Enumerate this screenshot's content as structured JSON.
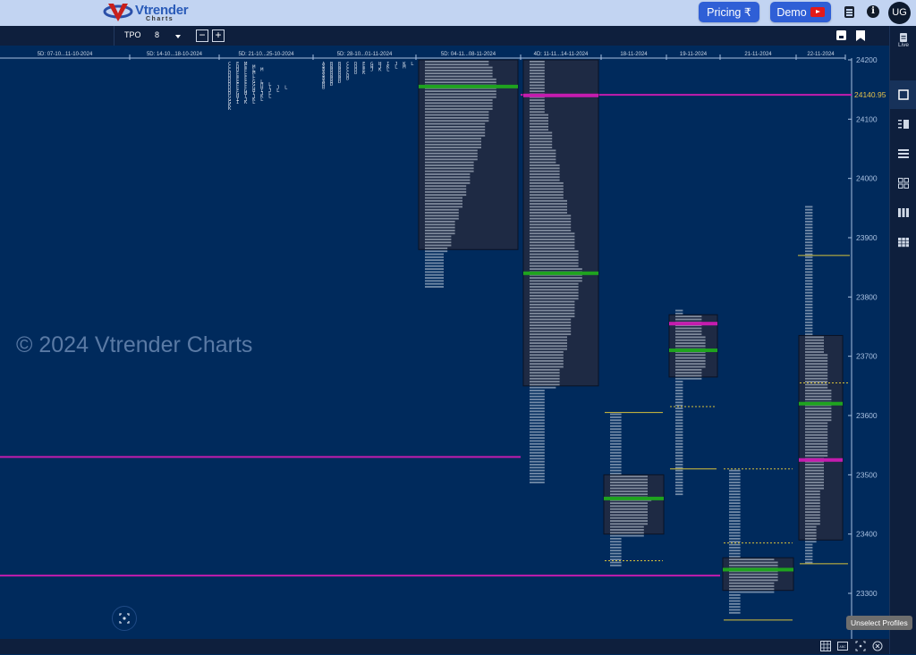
{
  "header": {
    "logo_text": "Vtrender",
    "logo_sub": "Charts",
    "pricing_label": "Pricing ₹",
    "demo_label": "Demo",
    "avatar_initials": "UG",
    "icons": [
      "notes-icon",
      "info-icon"
    ]
  },
  "toolbar": {
    "chart_type": "TPO",
    "tpo_size": "8",
    "zoom_out": "−",
    "zoom_in": "+",
    "icons": [
      "save-icon",
      "bookmark-add-icon"
    ]
  },
  "right_panel": {
    "live_label": "Live",
    "items": [
      "single-profile-icon",
      "split-profile-icon",
      "rows-icon",
      "grid-2x2-icon",
      "columns-icon",
      "grid-3x3-icon"
    ],
    "active_index": 0
  },
  "watermark": "© 2024 Vtrender Charts",
  "tooltip": "Unselect Profiles",
  "bottom_icons": [
    "table-icon",
    "abc-icon",
    "focus-icon",
    "close-circle-icon"
  ],
  "colors": {
    "background": "#002a5c",
    "profile_box": "#1e2a44",
    "poc_green": "#1fa31f",
    "vpoc_magenta": "#c41cae",
    "ib_yellow": "#d8c23a",
    "letters": "#cfd8e6",
    "axis": "#a8c0e0",
    "last_price": "#e6c14a"
  },
  "chart_data": {
    "type": "tpo_market_profile",
    "instrument_price_axis": "y",
    "y_ticks": [
      24200,
      24100,
      24000,
      23900,
      23800,
      23700,
      23600,
      23500,
      23400,
      23300
    ],
    "ylim": [
      23245,
      24225
    ],
    "last_price": "24140.95",
    "profiles": [
      {
        "label": "5D: 07-10...11-10-2024",
        "letters": []
      },
      {
        "label": "5D: 14-10...18-10-2024",
        "letters": []
      },
      {
        "label": "5D: 21-10...25-10-2024",
        "high": 24200,
        "low": 24080,
        "letters": [
          "CEM",
          "CDEM",
          "CDELM",
          "DELM",
          "DEFL",
          "DEFL",
          "DEFGL",
          "DEFGHL",
          "DEFGHIJL",
          "DFGHIJL",
          "DGHIJL",
          "GHIJKL",
          "GIJKL",
          "GIKL",
          "K",
          "K"
        ]
      },
      {
        "label": "5D: 28-10...01-11-2024",
        "high": 24200,
        "low": 24140,
        "letters": [
          "ABBCDEGHIJKLM",
          "ABBCDEHJKLM",
          "ABBCDEJKL",
          "ABBCDK",
          "ABBD",
          "ABBD",
          "ABD",
          "BD",
          "B"
        ]
      },
      {
        "label": "5D: 04-11...08-11-2024",
        "high": 24200,
        "low": 23815,
        "poc": 24155,
        "value_area": [
          23880,
          24200
        ]
      },
      {
        "label": "4D: 11-11...14-11-2024",
        "high": 24200,
        "low": 23485,
        "poc": 23840,
        "value_area": [
          23650,
          24200
        ],
        "vpoc": 24140
      },
      {
        "label": "18-11-2024",
        "high": 23605,
        "low": 23345,
        "poc": 23460,
        "value_area": [
          23400,
          23500
        ]
      },
      {
        "label": "19-11-2024",
        "high": 23780,
        "low": 23465,
        "poc": 23710,
        "value_area": [
          23665,
          23770
        ],
        "vpoc": 23755
      },
      {
        "label": "21-11-2024",
        "high": 23510,
        "low": 23265,
        "poc": 23340,
        "value_area": [
          23305,
          23360
        ]
      },
      {
        "label": "22-11-2024",
        "high": 23955,
        "low": 23350,
        "poc": 23620,
        "value_area": [
          23390,
          23735
        ],
        "vpoc": 23525
      }
    ],
    "naked_vpocs": [
      24140.95,
      23530,
      23330
    ]
  }
}
